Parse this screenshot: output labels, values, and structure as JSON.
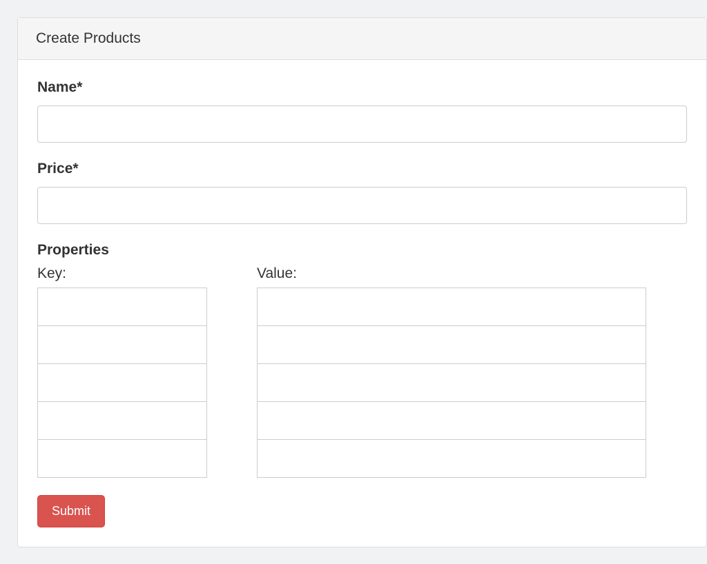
{
  "panel": {
    "title": "Create Products"
  },
  "form": {
    "name": {
      "label": "Name*",
      "value": ""
    },
    "price": {
      "label": "Price*",
      "value": ""
    },
    "properties": {
      "title": "Properties",
      "key_label": "Key:",
      "value_label": "Value:",
      "rows": 5,
      "keys": [
        "",
        "",
        "",
        "",
        ""
      ],
      "values": [
        "",
        "",
        "",
        "",
        ""
      ]
    },
    "submit_label": "Submit"
  }
}
